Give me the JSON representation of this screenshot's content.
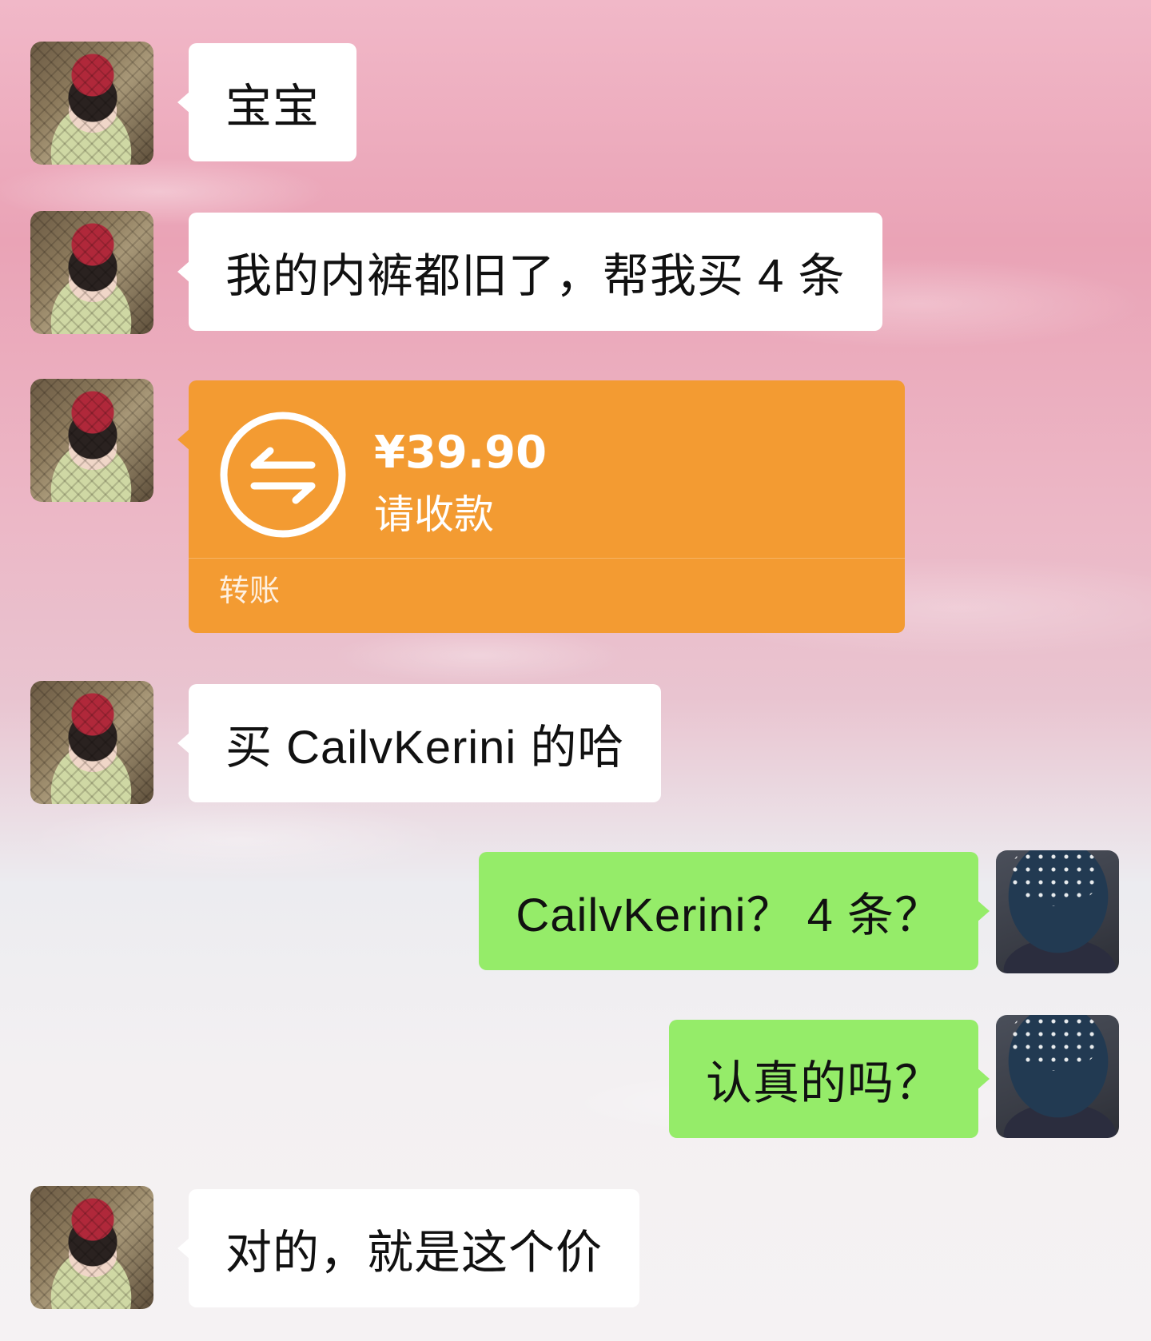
{
  "messages": [
    {
      "side": "left",
      "text": "宝宝"
    },
    {
      "side": "left",
      "text": "我的内裤都旧了，帮我买 4 条"
    },
    {
      "side": "left",
      "type": "transfer",
      "amount": "¥39.90",
      "status": "请收款",
      "label": "转账"
    },
    {
      "side": "left",
      "text": "买 CailvKerini 的哈"
    },
    {
      "side": "right",
      "text": "CailvKerini？ 4 条？"
    },
    {
      "side": "right",
      "text": "认真的吗？"
    },
    {
      "side": "left",
      "text": "对的，就是这个价"
    }
  ],
  "colors": {
    "incoming_bubble": "#ffffff",
    "outgoing_bubble": "#95ec69",
    "transfer_card": "#f39b32"
  },
  "icons": {
    "transfer": "transfer-arrows-icon",
    "avatar_left": "avatar-child-red-cap",
    "avatar_right": "avatar-woman-knit-hat"
  }
}
